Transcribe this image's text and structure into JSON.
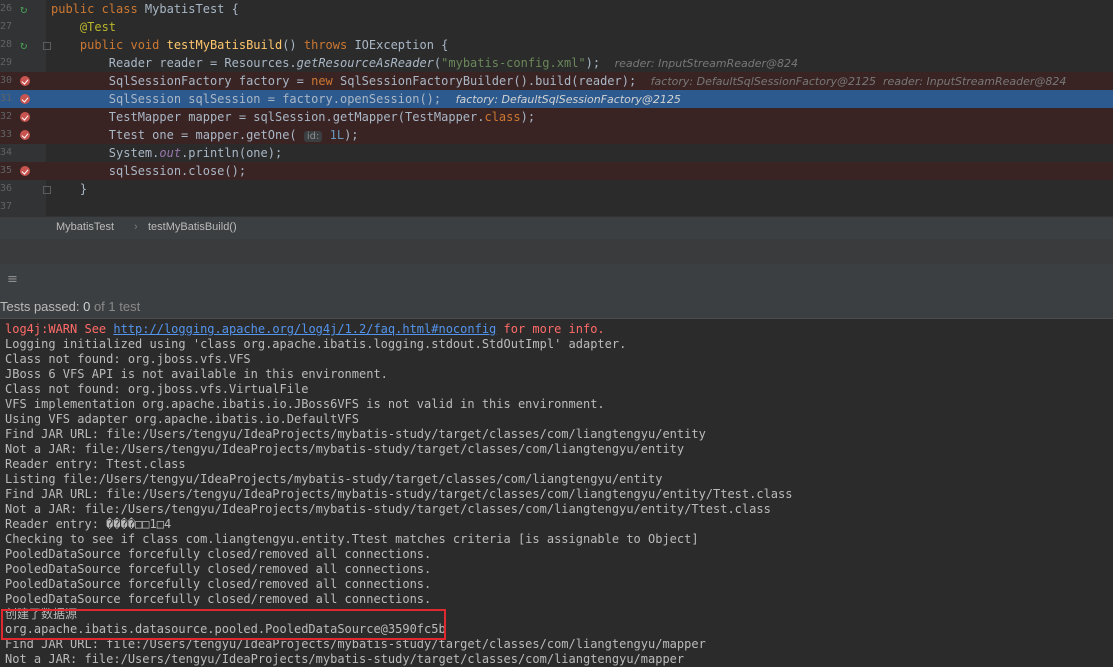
{
  "editor": {
    "lines": [
      {
        "num": "26",
        "gutter": "run",
        "segments": [
          {
            "t": "public class ",
            "c": "kw"
          },
          {
            "t": "MybatisTest {",
            "c": ""
          }
        ]
      },
      {
        "num": "27",
        "gutter": "",
        "segments": [
          {
            "t": "    @Test",
            "c": "ann"
          }
        ]
      },
      {
        "num": "28",
        "gutter": "run",
        "segments": [
          {
            "t": "    public void ",
            "c": "kw"
          },
          {
            "t": "testMyBatisBuild",
            "c": "fn"
          },
          {
            "t": "() ",
            "c": ""
          },
          {
            "t": "throws ",
            "c": "kw"
          },
          {
            "t": "IOException {",
            "c": ""
          }
        ]
      },
      {
        "num": "29",
        "gutter": "",
        "segments": [
          {
            "t": "        Reader reader = Resources.",
            "c": ""
          },
          {
            "t": "getResourceAsReader",
            "c": "it"
          },
          {
            "t": "(",
            "c": ""
          },
          {
            "t": "\"mybatis-config.xml\"",
            "c": "str"
          },
          {
            "t": ");  ",
            "c": ""
          },
          {
            "t": "reader: InputStreamReader@824",
            "c": "hint"
          }
        ]
      },
      {
        "num": "30",
        "gutter": "bp",
        "segments": [
          {
            "t": "        SqlSessionFactory factory = ",
            "c": ""
          },
          {
            "t": "new ",
            "c": "kw"
          },
          {
            "t": "SqlSessionFactoryBuilder().build(reader);  ",
            "c": ""
          },
          {
            "t": "factory: DefaultSqlSessionFactory@2125  reader: InputStreamReader@824",
            "c": "hint"
          }
        ]
      },
      {
        "num": "31",
        "gutter": "bp",
        "segments": [
          {
            "t": "        SqlSession sqlSession = factory.openSession();  ",
            "c": ""
          },
          {
            "t": "factory: DefaultSqlSessionFactory@2125",
            "c": "inline"
          }
        ]
      },
      {
        "num": "32",
        "gutter": "bp",
        "segments": [
          {
            "t": "        TestMapper mapper = sqlSession.getMapper(TestMapper.",
            "c": ""
          },
          {
            "t": "class",
            "c": "kw"
          },
          {
            "t": ");",
            "c": ""
          }
        ]
      },
      {
        "num": "33",
        "gutter": "bp",
        "segments": [
          {
            "t": "        Ttest one = mapper.getOne( ",
            "c": ""
          },
          {
            "t": "id:",
            "c": "hintbox"
          },
          {
            "t": " 1L",
            "c": "num"
          },
          {
            "t": ");",
            "c": ""
          }
        ]
      },
      {
        "num": "34",
        "gutter": "",
        "segments": [
          {
            "t": "        System.",
            "c": ""
          },
          {
            "t": "out",
            "c": "field"
          },
          {
            "t": ".println(one);",
            "c": ""
          }
        ]
      },
      {
        "num": "35",
        "gutter": "bp",
        "segments": [
          {
            "t": "        sqlSession.close();",
            "c": ""
          }
        ]
      },
      {
        "num": "36",
        "gutter": "",
        "segments": [
          {
            "t": "    }",
            "c": ""
          }
        ]
      },
      {
        "num": "37",
        "gutter": "",
        "segments": [
          {
            "t": "",
            "c": ""
          }
        ]
      }
    ]
  },
  "breadcrumbs": {
    "class_name": "MybatisTest",
    "separator": "›",
    "method_name": "testMyBatisBuild()"
  },
  "toolbar": {
    "menu_icon": "≡"
  },
  "status": {
    "prefix": "Tests passed: ",
    "passed": "0",
    "suffix": " of 1 test"
  },
  "console": {
    "warn": {
      "prefix": "log4j:WARN See ",
      "link": "http://logging.apache.org/log4j/1.2/faq.html#noconfig",
      "suffix": " for more info."
    },
    "lines": [
      "Logging initialized using 'class org.apache.ibatis.logging.stdout.StdOutImpl' adapter.",
      "Class not found: org.jboss.vfs.VFS",
      "JBoss 6 VFS API is not available in this environment.",
      "Class not found: org.jboss.vfs.VirtualFile",
      "VFS implementation org.apache.ibatis.io.JBoss6VFS is not valid in this environment.",
      "Using VFS adapter org.apache.ibatis.io.DefaultVFS",
      "Find JAR URL: file:/Users/tengyu/IdeaProjects/mybatis-study/target/classes/com/liangtengyu/entity",
      "Not a JAR: file:/Users/tengyu/IdeaProjects/mybatis-study/target/classes/com/liangtengyu/entity",
      "Reader entry: Ttest.class",
      "Listing file:/Users/tengyu/IdeaProjects/mybatis-study/target/classes/com/liangtengyu/entity",
      "Find JAR URL: file:/Users/tengyu/IdeaProjects/mybatis-study/target/classes/com/liangtengyu/entity/Ttest.class",
      "Not a JAR: file:/Users/tengyu/IdeaProjects/mybatis-study/target/classes/com/liangtengyu/entity/Ttest.class",
      "Reader entry: ����□□1□4",
      "Checking to see if class com.liangtengyu.entity.Ttest matches criteria [is assignable to Object]",
      "PooledDataSource forcefully closed/removed all connections.",
      "PooledDataSource forcefully closed/removed all connections.",
      "PooledDataSource forcefully closed/removed all connections.",
      "PooledDataSource forcefully closed/removed all connections.",
      "创建了数据源",
      "org.apache.ibatis.datasource.pooled.PooledDataSource@3590fc5b",
      "Find JAR URL: file:/Users/tengyu/IdeaProjects/mybatis-study/target/classes/com/liangtengyu/mapper",
      "Not a JAR: file:/Users/tengyu/IdeaProjects/mybatis-study/target/classes/com/liangtengyu/mapper"
    ]
  },
  "colors": {
    "breakpoint_line": "#3a2323",
    "current_line": "#2d5a8e",
    "highlight_box": "#e0292e",
    "warn_text": "#ff6b68",
    "link": "#5394ec"
  }
}
